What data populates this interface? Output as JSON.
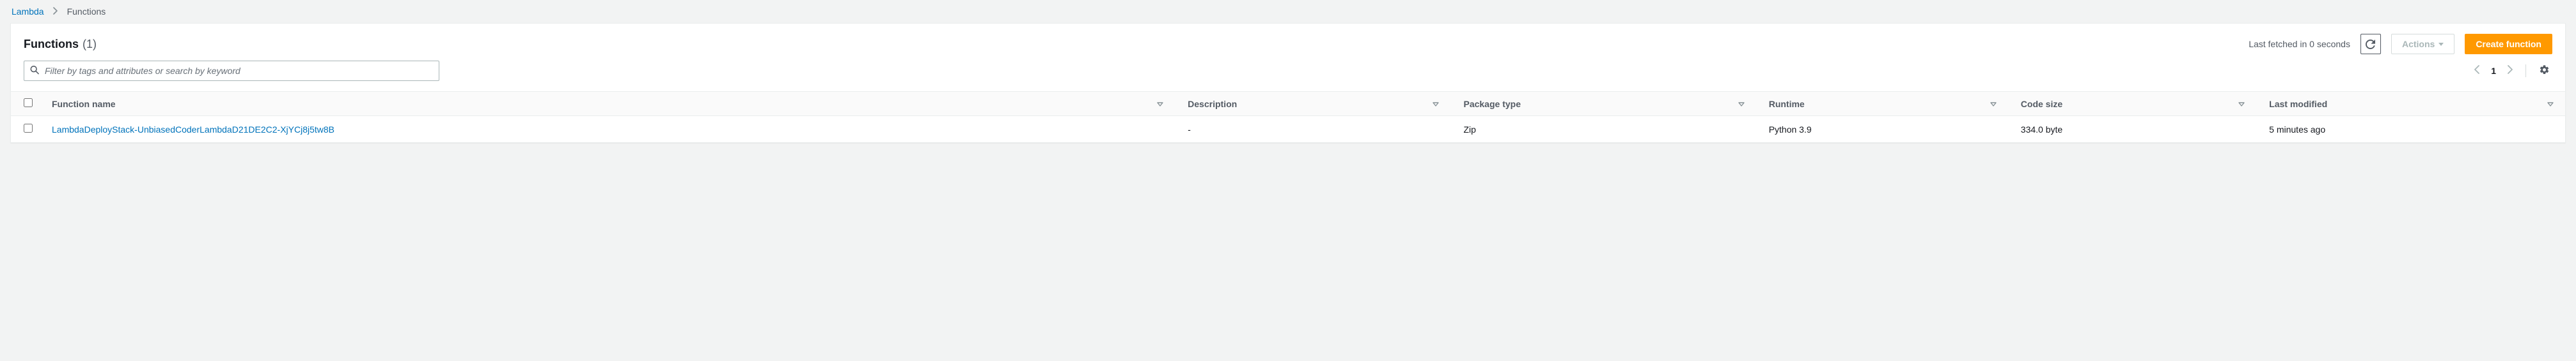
{
  "breadcrumb": {
    "root": "Lambda",
    "current": "Functions"
  },
  "header": {
    "title": "Functions",
    "count": "(1)",
    "last_fetched": "Last fetched in 0 seconds",
    "actions_label": "Actions",
    "create_label": "Create function"
  },
  "search": {
    "placeholder": "Filter by tags and attributes or search by keyword"
  },
  "pager": {
    "current": "1"
  },
  "table": {
    "columns": {
      "name": "Function name",
      "description": "Description",
      "package_type": "Package type",
      "runtime": "Runtime",
      "code_size": "Code size",
      "last_modified": "Last modified"
    },
    "rows": [
      {
        "name": "LambdaDeployStack-UnbiasedCoderLambdaD21DE2C2-XjYCj8j5tw8B",
        "description": "-",
        "package_type": "Zip",
        "runtime": "Python 3.9",
        "code_size": "334.0 byte",
        "last_modified": "5 minutes ago"
      }
    ]
  }
}
